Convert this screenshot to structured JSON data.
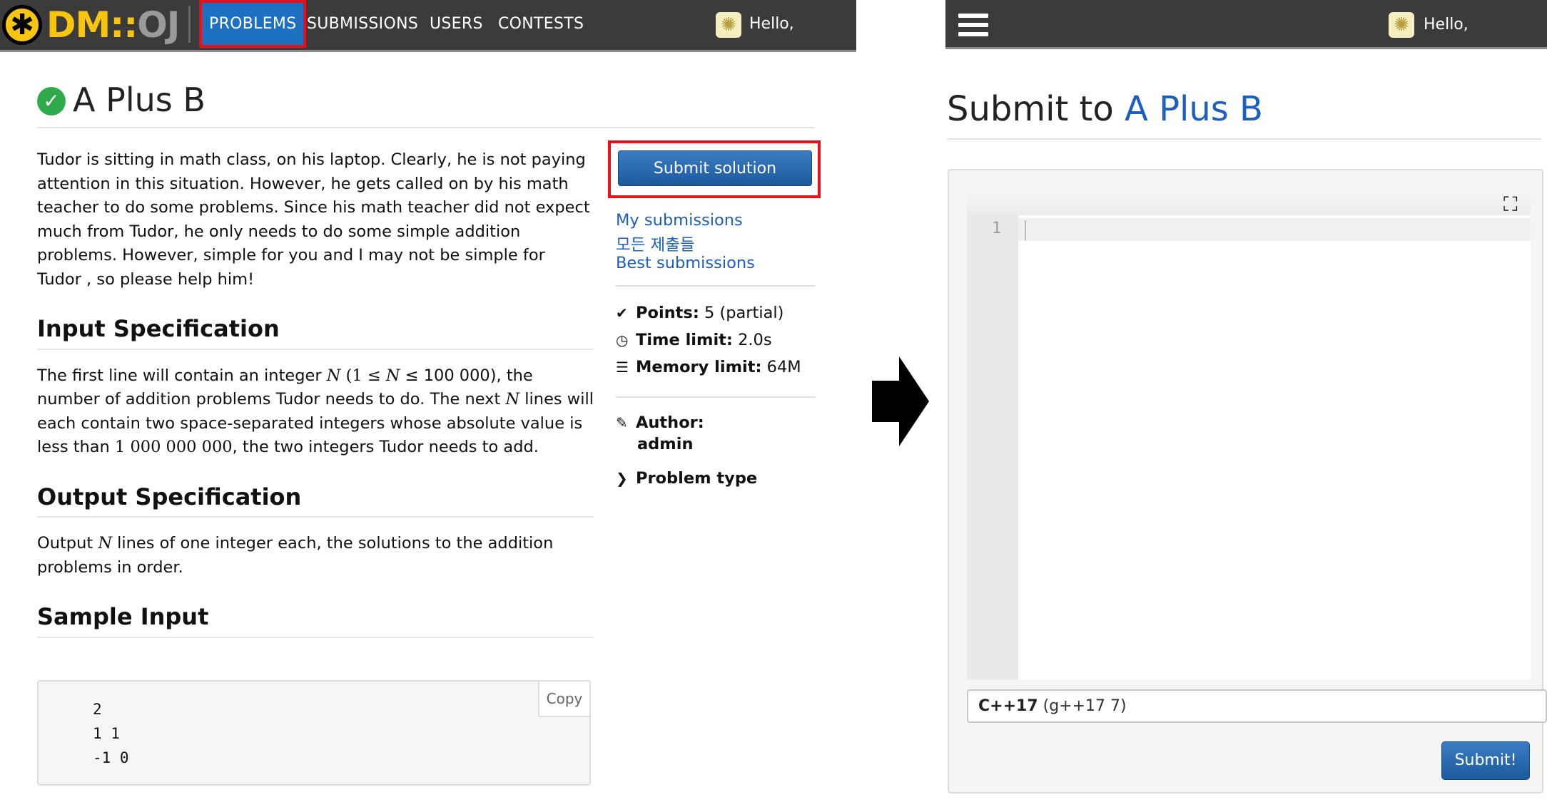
{
  "left": {
    "logo": {
      "dm": "DM",
      "sep": "::",
      "oj": "OJ"
    },
    "nav": [
      "PROBLEMS",
      "SUBMISSIONS",
      "USERS",
      "CONTESTS"
    ],
    "hello": "Hello,",
    "title": "A Plus B",
    "intro": "Tudor is sitting in math class, on his laptop. Clearly, he is not paying attention in this situation. However, he gets called on by his math teacher to do some problems. Since his math teacher did not expect much from Tudor, he only needs to do some simple addition problems. However, simple for you and I may not be simple for Tudor , so please help him!",
    "input_spec": {
      "heading": "Input Specification",
      "t1": "The first line will contain an integer ",
      "n": "N",
      "p1": " (1 ≤ ",
      "p2": " ≤ 100 000), the number of addition problems Tudor needs to do. The next ",
      "t2": " lines will each contain two space-separated integers whose absolute value is less than ",
      "big": "1 000 000 000",
      "t3": ", the two integers Tudor needs to add."
    },
    "output_spec": {
      "heading": "Output Specification",
      "t1": "Output ",
      "n": "N",
      "t2": " lines of one integer each, the solutions to the addition problems in order."
    },
    "sample": {
      "heading": "Sample Input",
      "content": "2\n1 1\n-1 0",
      "copy": "Copy"
    },
    "sidebar": {
      "submit": "Submit solution",
      "links": [
        "My submissions",
        "모든 제출들",
        "Best submissions"
      ],
      "points_label": "Points:",
      "points_value": "5 (partial)",
      "time_label": "Time limit:",
      "time_value": "2.0s",
      "memory_label": "Memory limit:",
      "memory_value": "64M",
      "author_label": "Author:",
      "author_value": "admin",
      "problem_type": "Problem type"
    }
  },
  "right": {
    "hello": "Hello,",
    "title_prefix": "Submit to ",
    "title_link": "A Plus B",
    "line_number": "1",
    "language_bold": "C++17",
    "language_rest": " (g++17 7)",
    "submit": "Submit!"
  },
  "icons": {
    "check": "check-circle-icon",
    "points": "checkmark-icon",
    "time": "clock-icon",
    "memory": "server-icon",
    "author": "edit-icon",
    "type": "chevron-right-icon",
    "menu": "hamburger-icon",
    "fullscreen": "expand-icon",
    "arrow": "right-arrow-icon"
  },
  "colors": {
    "navbar": "#3b3b3b",
    "nav_active": "#1d6fc2",
    "highlight": "#e8101a",
    "link": "#1d5fbf",
    "button": "#1d5a9c",
    "logo": "#f7c510",
    "success": "#2eaa4a"
  }
}
